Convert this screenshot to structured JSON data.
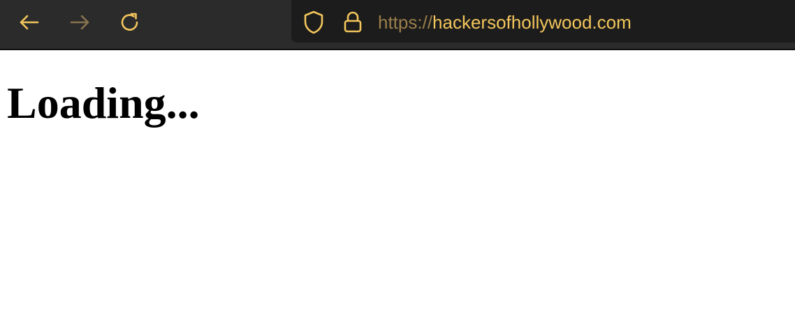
{
  "browser": {
    "nav": {
      "back_icon": "arrow-left-icon",
      "forward_icon": "arrow-right-icon",
      "reload_icon": "reload-icon"
    },
    "urlbar": {
      "shield_icon": "shield-icon",
      "lock_icon": "lock-icon",
      "url_scheme": "https://",
      "url_host": "hackersofhollywood.com"
    },
    "colors": {
      "toolbar_bg": "#2b2b2b",
      "urlbar_bg": "#1c1c1c",
      "accent": "#f3c65c",
      "accent_dim": "#9a7e4a"
    }
  },
  "page": {
    "heading": "Loading..."
  }
}
